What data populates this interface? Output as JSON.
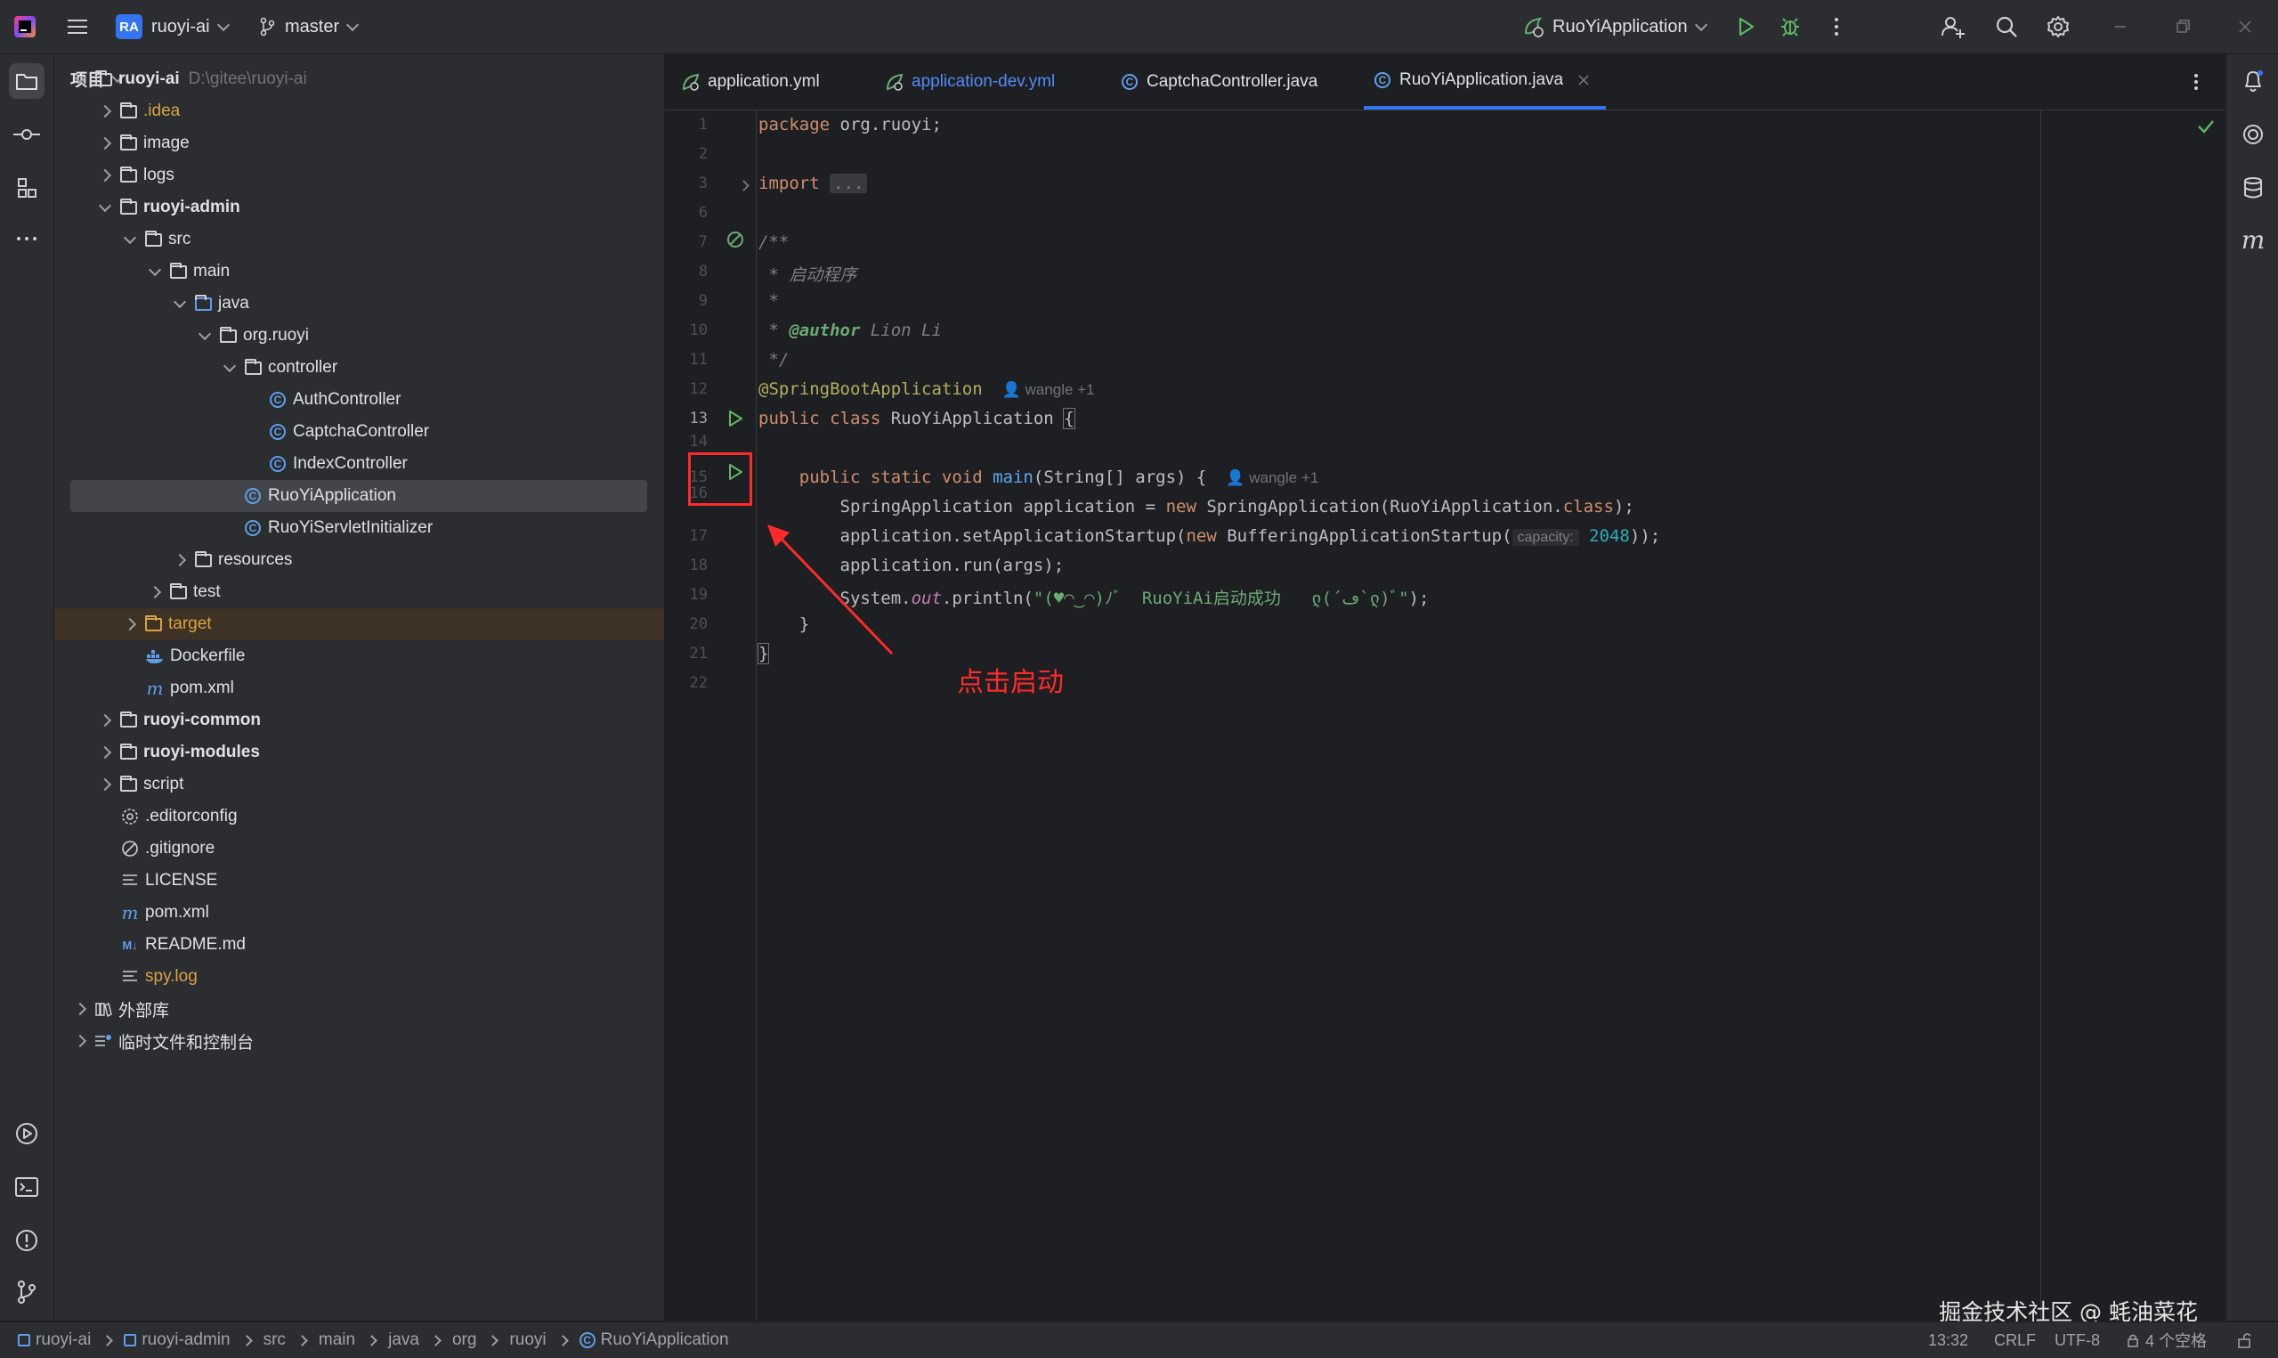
{
  "titlebar": {
    "project_badge": "RA",
    "project_name": "ruoyi-ai",
    "branch": "master",
    "run_config": "RuoYiApplication"
  },
  "project_panel": {
    "header": "项目",
    "tree": [
      {
        "label": "ruoyi-ai",
        "path": "D:\\gitee\\ruoyi-ai"
      },
      {
        "label": ".idea"
      },
      {
        "label": "image"
      },
      {
        "label": "logs"
      },
      {
        "label": "ruoyi-admin"
      },
      {
        "label": "src"
      },
      {
        "label": "main"
      },
      {
        "label": "java"
      },
      {
        "label": "org.ruoyi"
      },
      {
        "label": "controller"
      },
      {
        "label": "AuthController"
      },
      {
        "label": "CaptchaController"
      },
      {
        "label": "IndexController"
      },
      {
        "label": "RuoYiApplication"
      },
      {
        "label": "RuoYiServletInitializer"
      },
      {
        "label": "resources"
      },
      {
        "label": "test"
      },
      {
        "label": "target"
      },
      {
        "label": "Dockerfile"
      },
      {
        "label": "pom.xml"
      },
      {
        "label": "ruoyi-common"
      },
      {
        "label": "ruoyi-modules"
      },
      {
        "label": "script"
      },
      {
        "label": ".editorconfig"
      },
      {
        "label": ".gitignore"
      },
      {
        "label": "LICENSE"
      },
      {
        "label": "pom.xml"
      },
      {
        "label": "README.md"
      },
      {
        "label": "spy.log"
      },
      {
        "label": "外部库"
      },
      {
        "label": "临时文件和控制台"
      }
    ]
  },
  "tabs": [
    {
      "label": "application.yml"
    },
    {
      "label": "application-dev.yml"
    },
    {
      "label": "CaptchaController.java"
    },
    {
      "label": "RuoYiApplication.java"
    }
  ],
  "editor": {
    "line_numbers": [
      "1",
      "2",
      "3",
      "6",
      "7",
      "8",
      "9",
      "10",
      "11",
      "12",
      "13",
      "14",
      "15",
      "16",
      "17",
      "18",
      "19",
      "20",
      "21",
      "22"
    ],
    "lines": {
      "l1_kw": "package",
      "l1_rest": " org.ruoyi;",
      "l3_kw": "import",
      "l3_fold": "...",
      "l7": "/**",
      "l8": " * 启动程序",
      "l9": " *",
      "l10_star": " * ",
      "l10_tag": "@author",
      "l10_name": " Lion Li",
      "l11": " */",
      "l12_ann": "@SpringBootApplication",
      "l12_hint": "wangle +1",
      "l13_kw": "public class",
      "l13_name": " RuoYiApplication ",
      "l13_brace": "{",
      "l15_kw": "public static void",
      "l15_fn": " main",
      "l15_rest": "(String[] args) {",
      "l15_hint": "wangle +1",
      "l16_a": "SpringApplication application = ",
      "l16_kw": "new",
      "l16_b": " SpringApplication(RuoYiApplication.",
      "l16_cls": "class",
      "l16_c": ");",
      "l17_a": "application.setApplicationStartup(",
      "l17_kw": "new",
      "l17_b": " BufferingApplicationStartup(",
      "l17_inlay": "capacity:",
      "l17_num": "2048",
      "l17_c": "));",
      "l18": "application.run(args);",
      "l19_a": "System.",
      "l19_out": "out",
      "l19_b": ".println(",
      "l19_str": "\"(♥◠‿◠)ﾉﾞ  RuoYiAi启动成功   ლ(´ڡ`ლ)ﾞ\"",
      "l19_c": ");",
      "l20": "}",
      "l21": "}"
    },
    "annotation_text": "点击启动"
  },
  "statusbar": {
    "crumbs": [
      "ruoyi-ai",
      "ruoyi-admin",
      "src",
      "main",
      "java",
      "org",
      "ruoyi",
      "RuoYiApplication"
    ],
    "position": "13:32",
    "line_sep": "CRLF",
    "encoding": "UTF-8",
    "indent": "4 个空格"
  },
  "watermark": "掘金技术社区 @ 蚝油菜花",
  "colors": {
    "accent": "#3574f0",
    "annotation_red": "#ff2a2a",
    "run_green": "#5fb865"
  }
}
